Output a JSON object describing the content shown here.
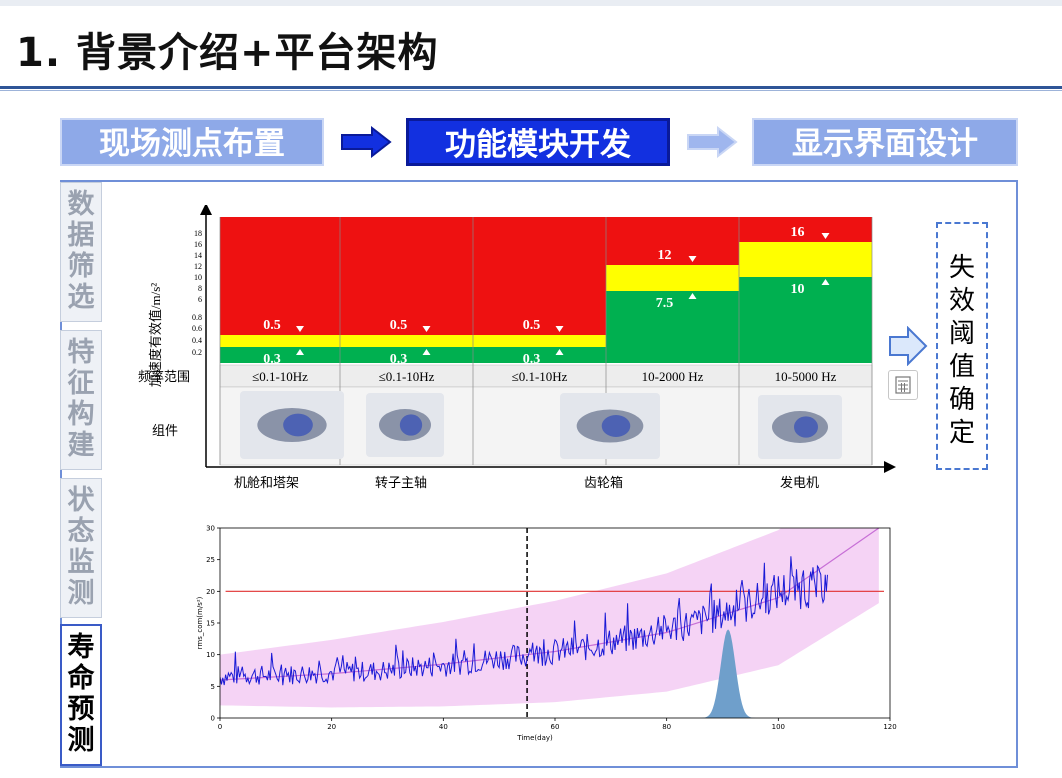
{
  "title": "1. 背景介绍+平台架构",
  "steps": [
    {
      "label": "现场测点布置",
      "active": false
    },
    {
      "label": "功能模块开发",
      "active": true
    },
    {
      "label": "显示界面设计",
      "active": false
    }
  ],
  "tabs": [
    {
      "label": "数\n据\n筛\n选",
      "active": false
    },
    {
      "label": "特\n征\n构\n建",
      "active": false
    },
    {
      "label": "状\n态\n监\n测",
      "active": false
    },
    {
      "label": "寿\n命\n预\n测",
      "active": true
    }
  ],
  "threshold": {
    "ylabel": "加速度有效值/m/s²",
    "row_freq_label": "频率范围",
    "row_comp_label": "组件",
    "ticks_low": [
      "0.2",
      "0.4",
      "0.6",
      "0.8"
    ],
    "ticks_high": [
      "6",
      "8",
      "10",
      "12",
      "14",
      "16",
      "18"
    ],
    "columns": [
      {
        "freq": "≤0.1-10Hz",
        "low": "0.3",
        "high": "0.5",
        "component": "机舱和塔架"
      },
      {
        "freq": "≤0.1-10Hz",
        "low": "0.3",
        "high": "0.5",
        "component": "转子主轴"
      },
      {
        "freq": "≤0.1-10Hz",
        "low": "0.3",
        "high": "0.5",
        "component": "齿轮箱"
      },
      {
        "freq": "10-2000 Hz",
        "low": "7.5",
        "high": "12",
        "component": ""
      },
      {
        "freq": "10-5000 Hz",
        "low": "10",
        "high": "16",
        "component": "发电机"
      }
    ],
    "colors": {
      "red": "#ee1111",
      "yellow": "#ffff00",
      "green": "#00b050"
    }
  },
  "fail_label": "失\n效\n阈\n值\n确\n定",
  "chart_data": {
    "type": "line",
    "xlabel": "Time(day)",
    "ylabel": "rms_com(m/s²)",
    "xlim": [
      0,
      120
    ],
    "ylim": [
      0,
      30
    ],
    "x_ticks": [
      "0",
      "20",
      "40",
      "60",
      "80",
      "100",
      "120"
    ],
    "y_ticks": [
      "0",
      "5",
      "10",
      "15",
      "20",
      "25",
      "30"
    ],
    "threshold_line": 20,
    "current_time": 55,
    "series": [
      {
        "x": [
          0,
          5,
          10,
          15,
          20,
          25,
          30,
          35,
          40,
          45,
          50,
          55,
          60,
          65,
          70,
          75,
          80,
          85,
          90,
          95,
          100,
          105,
          109
        ],
        "values": [
          6.5,
          6.8,
          6.7,
          7.0,
          7.2,
          7.3,
          7.5,
          8.0,
          8.3,
          8.8,
          9.5,
          9.8,
          10.5,
          11.0,
          12.0,
          12.8,
          14.0,
          15.0,
          16.5,
          18.0,
          20.0,
          20.5,
          21.0
        ]
      }
    ],
    "trend": {
      "x": [
        0,
        20,
        40,
        60,
        80,
        100,
        118
      ],
      "values": [
        6.0,
        7.0,
        8.5,
        10.5,
        13.5,
        19.0,
        30.0
      ]
    },
    "band_halfwidth": 4,
    "colors": {
      "series": "#1a1ad6",
      "trend": "#c76fd6",
      "band": "#f2c8f2",
      "threshold": "#e03030",
      "pdf": "#6f9fcb"
    }
  }
}
